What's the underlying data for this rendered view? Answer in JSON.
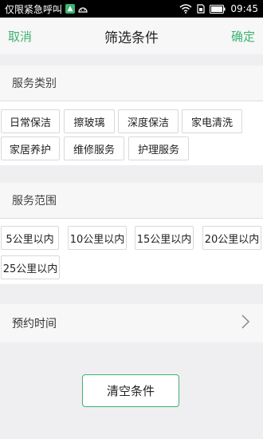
{
  "status": {
    "carrier": "仅限紧急呼叫",
    "time": "09:45"
  },
  "header": {
    "cancel": "取消",
    "title": "筛选条件",
    "confirm": "确定"
  },
  "service_type": {
    "heading": "服务类别",
    "tags": [
      "日常保洁",
      "擦玻璃",
      "深度保洁",
      "家电清洗",
      "家居养护",
      "维修服务",
      "护理服务"
    ]
  },
  "service_range": {
    "heading": "服务范围",
    "tags": [
      "5公里以内",
      "10公里以内",
      "15公里以内",
      "20公里以内",
      "25公里以内"
    ]
  },
  "appointment": {
    "label": "预约时间"
  },
  "clear_button": "清空条件",
  "colors": {
    "accent": "#3cb371",
    "background": "#efeff1"
  }
}
